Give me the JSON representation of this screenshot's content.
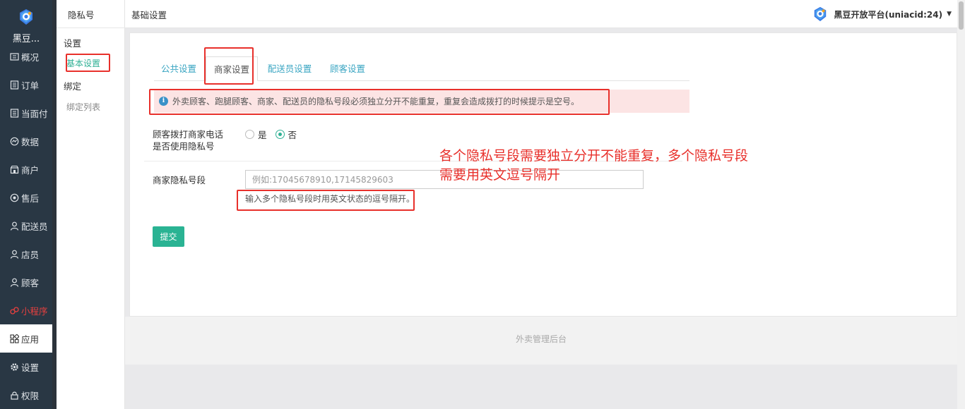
{
  "nav": {
    "logo_text": "黑豆...",
    "items": [
      {
        "label": "概况",
        "icon": "overview-icon"
      },
      {
        "label": "订单",
        "icon": "order-icon"
      },
      {
        "label": "当面付",
        "icon": "pay-icon"
      },
      {
        "label": "数据",
        "icon": "data-icon"
      },
      {
        "label": "商户",
        "icon": "store-icon"
      },
      {
        "label": "售后",
        "icon": "aftersale-icon"
      },
      {
        "label": "配送员",
        "icon": "courier-icon"
      },
      {
        "label": "店员",
        "icon": "staff-icon"
      },
      {
        "label": "顾客",
        "icon": "customer-icon"
      },
      {
        "label": "小程序",
        "icon": "miniprogram-icon"
      },
      {
        "label": "应用",
        "icon": "apps-icon"
      },
      {
        "label": "设置",
        "icon": "gear-icon"
      },
      {
        "label": "权限",
        "icon": "lock-icon"
      }
    ]
  },
  "subnav": {
    "title": "隐私号",
    "groups": [
      {
        "label": "设置",
        "links": [
          "基本设置"
        ]
      },
      {
        "label": "绑定",
        "links": [
          "绑定列表"
        ]
      }
    ]
  },
  "header": {
    "breadcrumb": "基础设置",
    "account": "黑豆开放平台(uniacid:24)"
  },
  "tabs": [
    "公共设置",
    "商家设置",
    "配送员设置",
    "顾客设置"
  ],
  "tip": "外卖顾客、跑腿顾客、商家、配送员的隐私号段必须独立分开不能重复，重复会造成拨打的时候提示是空号。",
  "form": {
    "radio_label_line1": "顾客拨打商家电话",
    "radio_label_line2": "是否使用隐私号",
    "radio_yes": "是",
    "radio_no": "否",
    "radio_selected": "否",
    "number_label": "商家隐私号段",
    "number_placeholder": "例如:17045678910,17145829603",
    "number_value": "",
    "number_help": "输入多个隐私号段时用英文状态的逗号隔开。",
    "submit": "提交"
  },
  "annotation": {
    "line1": "各个隐私号段需要独立分开不能重复，多个隐私号段",
    "line2": "需要用英文逗号隔开"
  },
  "footer": "外卖管理后台",
  "colors": {
    "nav_bg": "#293744",
    "accent": "#2ab393",
    "tab_link": "#39a5c2",
    "tip_bg": "#fce4e4",
    "highlight": "#e8302b"
  }
}
